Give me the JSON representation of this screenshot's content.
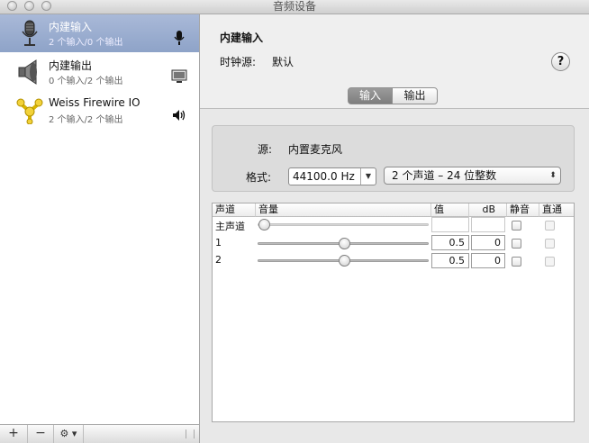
{
  "window": {
    "title": "音频设备"
  },
  "devices": [
    {
      "name": "内建输入",
      "sub": "2 个输入/0 个输出",
      "icon": "microphone-icon",
      "right_icon": "microphone-small-icon",
      "selected": true
    },
    {
      "name": "内建输出",
      "sub": "0 个输入/2 个输出",
      "icon": "speaker-icon",
      "right_icon": "display-icon",
      "selected": false
    },
    {
      "name": "Weiss Firewire IO",
      "sub": "2 个输入/2 个输出",
      "icon": "firewire-icon",
      "right_icon": "speaker-volume-icon",
      "selected": false
    }
  ],
  "toolbar": {
    "add_label": "+",
    "remove_label": "−",
    "gear_label": "⚙ ▾"
  },
  "detail": {
    "device_name": "内建输入",
    "clock_label": "时钟源:",
    "clock_value": "默认",
    "help_label": "?",
    "tabs": [
      {
        "label": "输入",
        "active": true
      },
      {
        "label": "输出",
        "active": false
      }
    ]
  },
  "source": {
    "label": "源:",
    "value": "内置麦克风"
  },
  "format": {
    "label": "格式:",
    "rate": "44100.0 Hz",
    "channels": "2 个声道 – 24 位整数"
  },
  "table": {
    "headers": {
      "channel": "声道",
      "volume": "音量",
      "value": "值",
      "db": "dB",
      "mute": "静音",
      "thru": "直通"
    },
    "rows": [
      {
        "channel": "主声道",
        "value": "",
        "db": "",
        "level": 0.0,
        "enabled": false
      },
      {
        "channel": "1",
        "value": "0.5",
        "db": "0",
        "level": 0.5,
        "enabled": true
      },
      {
        "channel": "2",
        "value": "0.5",
        "db": "0",
        "level": 0.5,
        "enabled": true
      }
    ]
  }
}
